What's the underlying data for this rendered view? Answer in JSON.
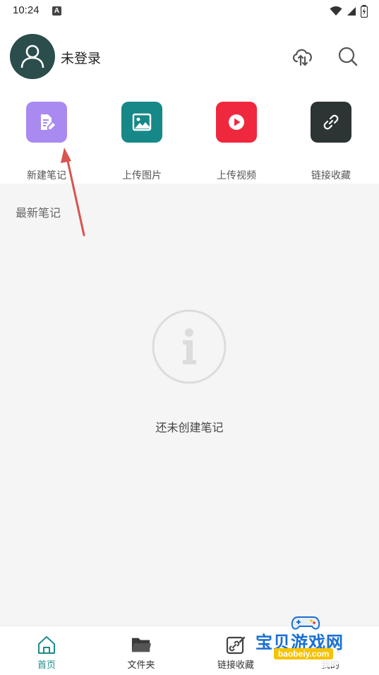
{
  "status_bar": {
    "time": "10:24",
    "notif_letter": "A"
  },
  "header": {
    "login_status": "未登录"
  },
  "quick_actions": [
    {
      "label": "新建笔记",
      "color": "#a98af0",
      "icon": "note-edit-icon"
    },
    {
      "label": "上传图片",
      "color": "#168887",
      "icon": "image-icon"
    },
    {
      "label": "上传视频",
      "color": "#f0283d",
      "icon": "play-icon"
    },
    {
      "label": "链接收藏",
      "color": "#2c3434",
      "icon": "link-icon"
    }
  ],
  "main": {
    "section_title": "最新笔记",
    "empty_text": "还未创建笔记"
  },
  "bottom_nav": [
    {
      "label": "首页",
      "icon": "home-icon",
      "active": true
    },
    {
      "label": "文件夹",
      "icon": "folder-icon",
      "active": false
    },
    {
      "label": "链接收藏",
      "icon": "link-edit-icon",
      "active": false
    },
    {
      "label": "我的",
      "icon": "profile-icon",
      "active": false
    }
  ],
  "watermark": {
    "title": "宝贝游戏网",
    "domain": "baobeiy.com"
  },
  "colors": {
    "accent": "#1e8c8a",
    "background": "#f5f5f5",
    "arrow": "#d9534f"
  }
}
